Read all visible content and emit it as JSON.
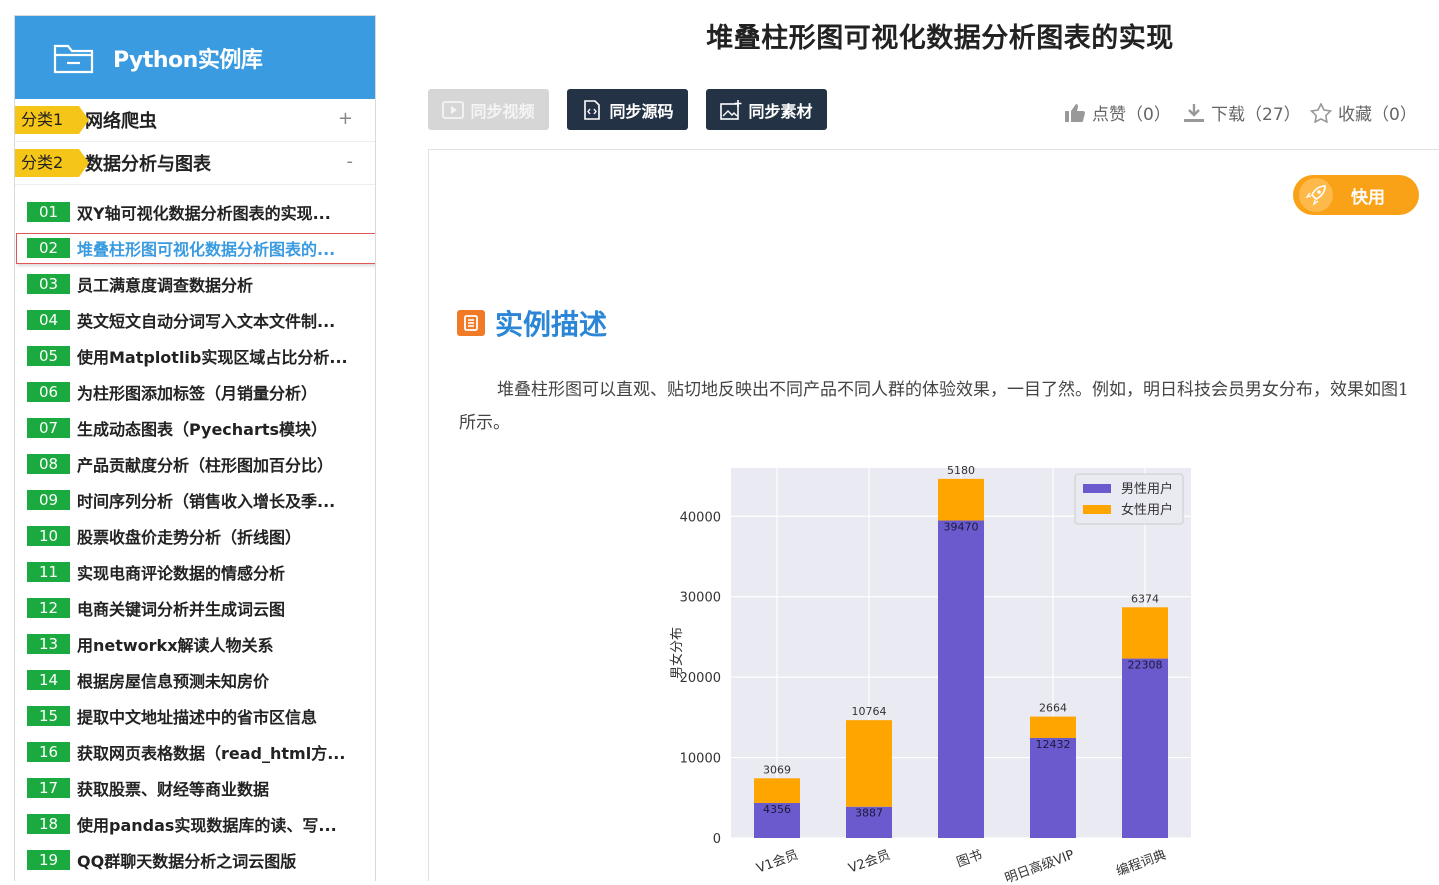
{
  "sidebar": {
    "title": "Python实例库",
    "categories": [
      {
        "tag": "分类1",
        "name": "网络爬虫",
        "toggle": "+"
      },
      {
        "tag": "分类2",
        "name": "数据分析与图表",
        "toggle": "-"
      }
    ],
    "items": [
      {
        "num": "01",
        "label": "双Y轴可视化数据分析图表的实现..."
      },
      {
        "num": "02",
        "label": "堆叠柱形图可视化数据分析图表的..."
      },
      {
        "num": "03",
        "label": "员工满意度调查数据分析"
      },
      {
        "num": "04",
        "label": "英文短文自动分词写入文本文件制..."
      },
      {
        "num": "05",
        "label": "使用Matplotlib实现区域占比分析..."
      },
      {
        "num": "06",
        "label": "为柱形图添加标签（月销量分析）"
      },
      {
        "num": "07",
        "label": "生成动态图表（Pyecharts模块）"
      },
      {
        "num": "08",
        "label": "产品贡献度分析（柱形图加百分比）"
      },
      {
        "num": "09",
        "label": "时间序列分析（销售收入增长及季..."
      },
      {
        "num": "10",
        "label": "股票收盘价走势分析（折线图）"
      },
      {
        "num": "11",
        "label": "实现电商评论数据的情感分析"
      },
      {
        "num": "12",
        "label": "电商关键词分析并生成词云图"
      },
      {
        "num": "13",
        "label": "用networkx解读人物关系"
      },
      {
        "num": "14",
        "label": "根据房屋信息预测未知房价"
      },
      {
        "num": "15",
        "label": "提取中文地址描述中的省市区信息"
      },
      {
        "num": "16",
        "label": "获取网页表格数据（read_html方..."
      },
      {
        "num": "17",
        "label": "获取股票、财经等商业数据"
      },
      {
        "num": "18",
        "label": "使用pandas实现数据库的读、写..."
      },
      {
        "num": "19",
        "label": "QQ群聊天数据分析之词云图版"
      }
    ]
  },
  "page_title": "堆叠柱形图可视化数据分析图表的实现",
  "toolbar": {
    "video": "同步视频",
    "source": "同步源码",
    "material": "同步素材"
  },
  "stats": {
    "like": "点赞（0）",
    "download": "下载（27）",
    "favorite": "收藏（0）"
  },
  "quick_label": "快用",
  "section_title": "实例描述",
  "description": "堆叠柱形图可以直观、贴切地反映出不同产品不同人群的体验效果，一目了然。例如，明日科技会员男女分布，效果如图1所示。",
  "colors": {
    "accent_blue": "#3a9be0",
    "male": "#6a5acd",
    "female": "#ffa500",
    "badge_green": "#1aaa3f",
    "dark_button": "#233245"
  },
  "chart_data": {
    "type": "bar",
    "stacked": true,
    "categories": [
      "V1会员",
      "V2会员",
      "图书",
      "明日高级VIP",
      "编程词典"
    ],
    "series": [
      {
        "name": "男性用户",
        "values": [
          4356,
          3887,
          39470,
          12432,
          22308
        ]
      },
      {
        "name": "女性用户",
        "values": [
          3069,
          10764,
          5180,
          2664,
          6374
        ]
      }
    ],
    "ylabel": "男女分布",
    "ylim": [
      0,
      46000
    ],
    "yticks": [
      "0",
      "10000",
      "20000",
      "30000",
      "40000"
    ],
    "legend_position": "top-right",
    "grid": true
  }
}
